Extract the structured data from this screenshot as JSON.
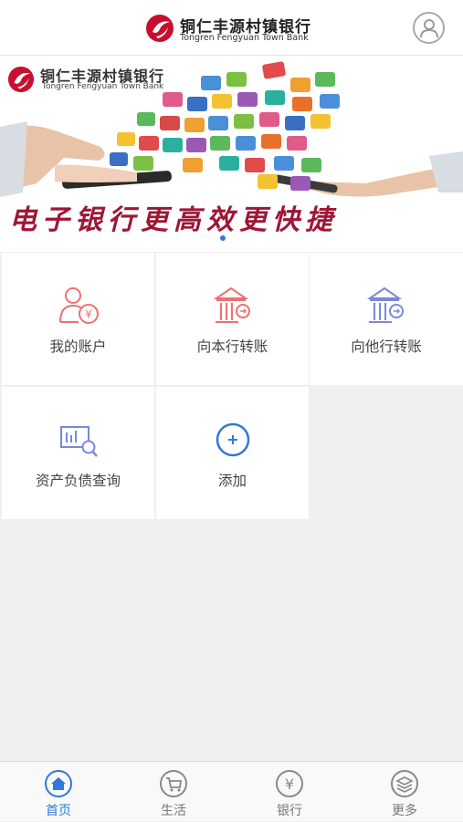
{
  "header": {
    "bank_name_cn": "铜仁丰源村镇银行",
    "bank_name_en": "Tongren Fengyuan Town Bank",
    "avatar_icon": "user-avatar-icon",
    "brand_color": "#c8102e"
  },
  "banner": {
    "bank_name_cn": "铜仁丰源村镇银行",
    "bank_name_en": "Tongren Fengyuan Town Bank",
    "slogan": "电子银行更高效更快捷",
    "slide_indicator_color": "#2f79d9"
  },
  "grid": {
    "items": [
      {
        "label": "我的账户",
        "icon": "account-yuan-icon"
      },
      {
        "label": "向本行转账",
        "icon": "bank-transfer-icon"
      },
      {
        "label": "向他行转账",
        "icon": "other-bank-transfer-icon"
      },
      {
        "label": "资产负债查询",
        "icon": "asset-query-icon"
      },
      {
        "label": "添加",
        "icon": "add-icon"
      }
    ]
  },
  "tabbar": {
    "tabs": [
      {
        "label": "首页",
        "icon": "home-icon",
        "active": true
      },
      {
        "label": "生活",
        "icon": "cart-icon",
        "active": false
      },
      {
        "label": "银行",
        "icon": "yuan-icon",
        "active": false
      },
      {
        "label": "更多",
        "icon": "layers-icon",
        "active": false
      }
    ],
    "active_color": "#2f79d9"
  }
}
